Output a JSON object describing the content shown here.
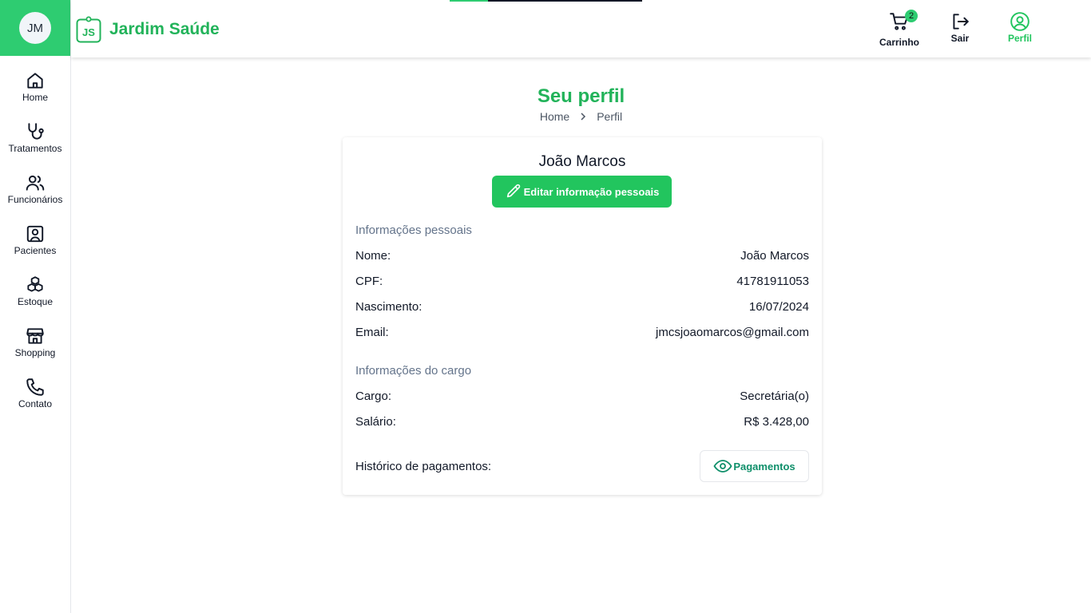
{
  "user": {
    "initials": "JM"
  },
  "brand": {
    "logo_text": "JS",
    "name": "Jardim Saúde",
    "accent": "#22b35a"
  },
  "nav": [
    {
      "label": "Home",
      "icon": "home-icon"
    },
    {
      "label": "Tratamentos",
      "icon": "stethoscope-icon"
    },
    {
      "label": "Funcionários",
      "icon": "users-icon"
    },
    {
      "label": "Pacientes",
      "icon": "patient-icon"
    },
    {
      "label": "Estoque",
      "icon": "boxes-icon"
    },
    {
      "label": "Shopping",
      "icon": "store-icon"
    },
    {
      "label": "Contato",
      "icon": "phone-icon"
    }
  ],
  "header": {
    "cart": {
      "label": "Carrinho",
      "count": "2",
      "icon": "cart-icon"
    },
    "logout": {
      "label": "Sair",
      "icon": "logout-icon"
    },
    "profile": {
      "label": "Perfil",
      "icon": "user-circle-icon"
    },
    "loading_progress": 0.2
  },
  "page": {
    "title": "Seu perfil",
    "breadcrumb": {
      "home": "Home",
      "current": "Perfil"
    }
  },
  "profile": {
    "name": "João Marcos",
    "edit_button": "Editar informação pessoais",
    "personal_title": "Informações pessoais",
    "personal": [
      {
        "label": "Nome:",
        "value": "João Marcos"
      },
      {
        "label": "CPF:",
        "value": "41781911053"
      },
      {
        "label": "Nascimento:",
        "value": "16/07/2024"
      },
      {
        "label": "Email:",
        "value": "jmcsjoaomarcos@gmail.com"
      }
    ],
    "job_title": "Informações do cargo",
    "job": [
      {
        "label": "Cargo:",
        "value": "Secretária(o)"
      },
      {
        "label": "Salário:",
        "value": "R$ 3.428,00"
      }
    ],
    "payments_label": "Histórico de pagamentos:",
    "payments_button": "Pagamentos"
  },
  "colors": {
    "primary": "#2ecc71",
    "button": "#22c55e",
    "payments": "#0f8f6a"
  }
}
